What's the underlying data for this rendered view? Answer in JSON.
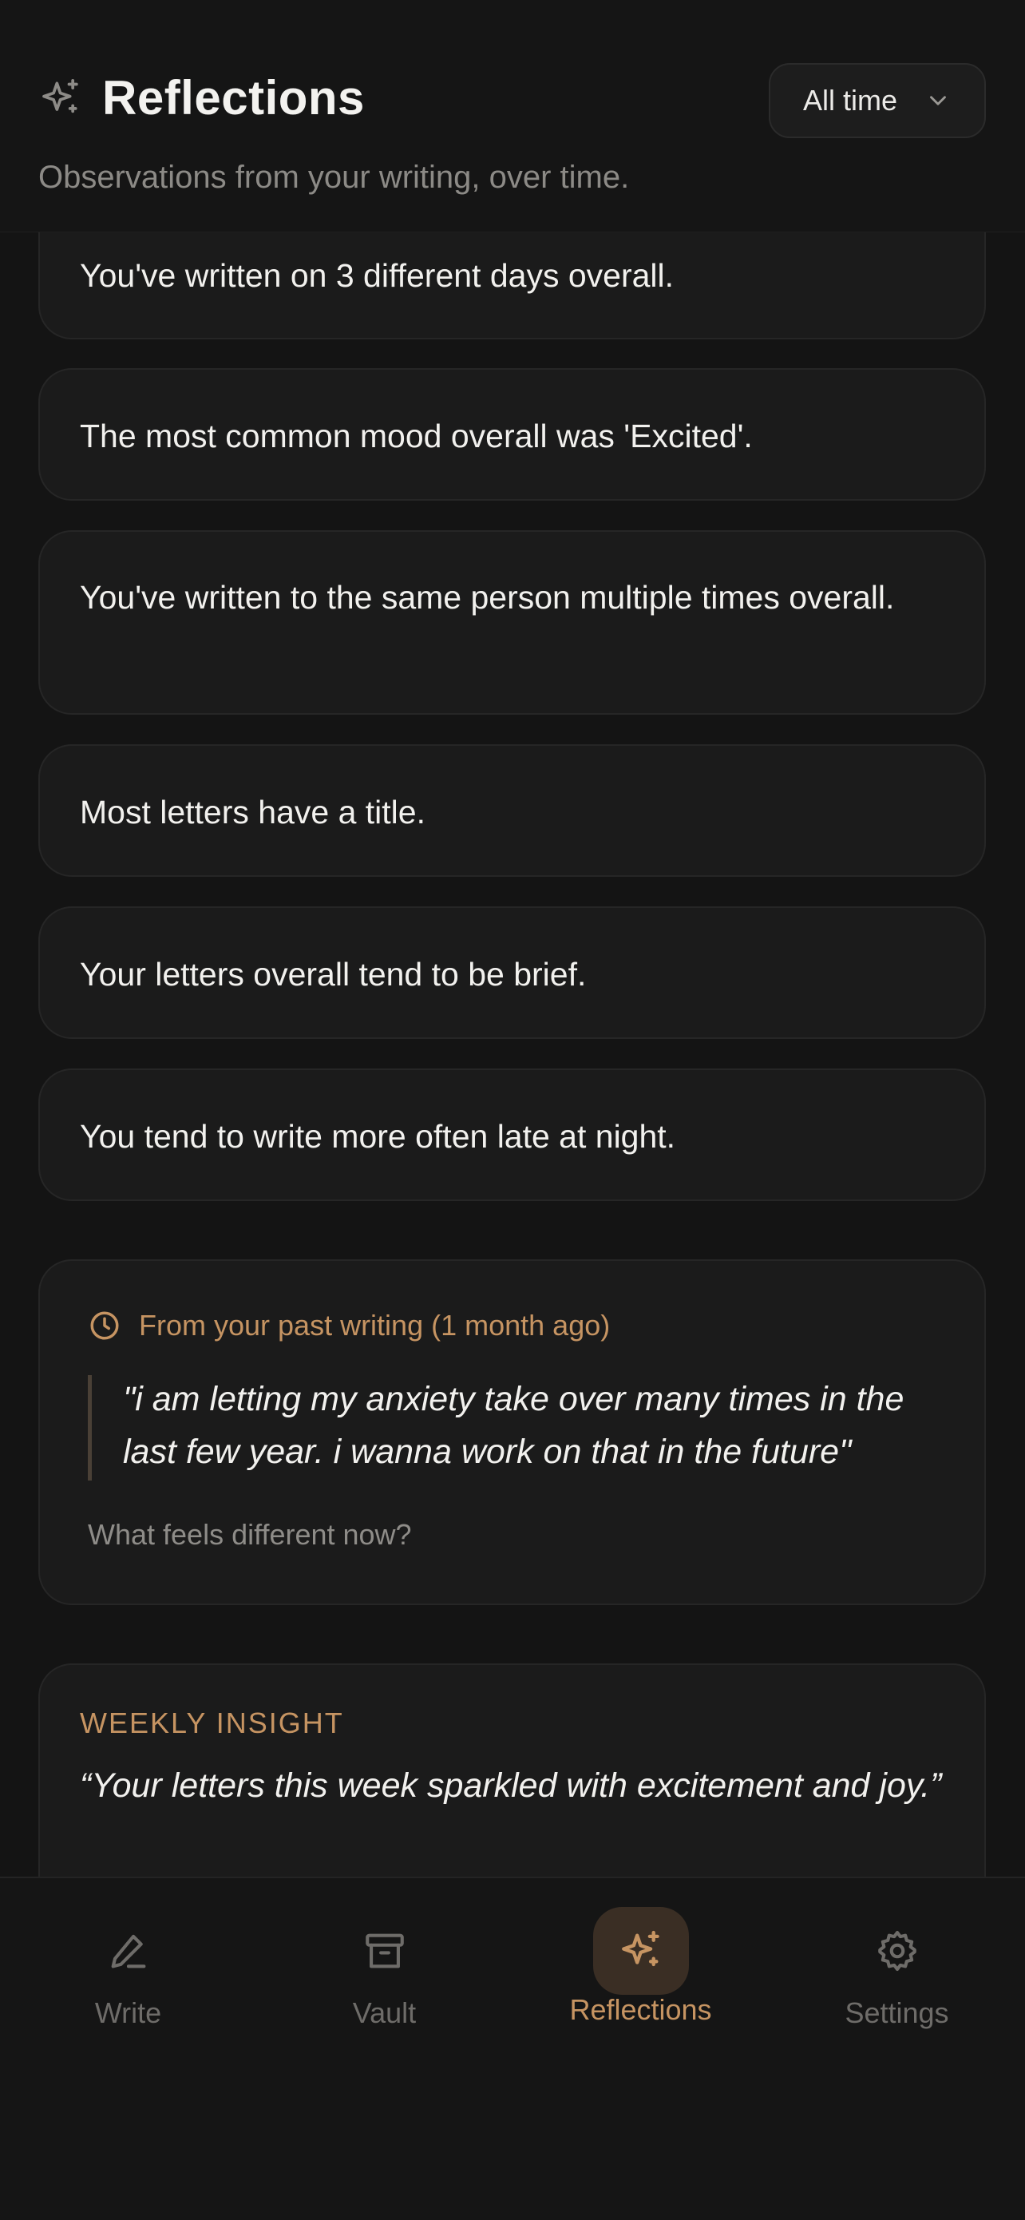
{
  "header": {
    "title": "Reflections",
    "subtitle": "Observations from your writing, over time.",
    "filter_label": "All time",
    "icon": "sparkles-icon"
  },
  "observations": [
    {
      "text": "You've written on 3 different days overall."
    },
    {
      "text": "The most common mood overall was 'Excited'."
    },
    {
      "text": "You've written to the same person multiple times overall."
    },
    {
      "text": "Most letters have a title."
    },
    {
      "text": "Your letters overall tend to be brief."
    },
    {
      "text": "You tend to write more often late at night."
    }
  ],
  "past_writing": {
    "label": "From your past writing (1 month ago)",
    "quote": "\"i am letting my anxiety take over many times in the last few year. i wanna work on that in the future\"",
    "prompt": "What feels different now?",
    "icon": "clock-icon"
  },
  "weekly_insight": {
    "label": "WEEKLY INSIGHT",
    "text": "“Your letters this week sparkled with excitement and joy.”"
  },
  "tabs": [
    {
      "label": "Write",
      "icon": "pencil-icon"
    },
    {
      "label": "Vault",
      "icon": "archive-icon"
    },
    {
      "label": "Reflections",
      "icon": "sparkles-icon",
      "active": true
    },
    {
      "label": "Settings",
      "icon": "gear-icon"
    }
  ],
  "colors": {
    "background": "#141414",
    "card": "#1b1b1b",
    "accent": "#c69462",
    "text": "#f2f1ee",
    "muted": "#8c8a86"
  }
}
